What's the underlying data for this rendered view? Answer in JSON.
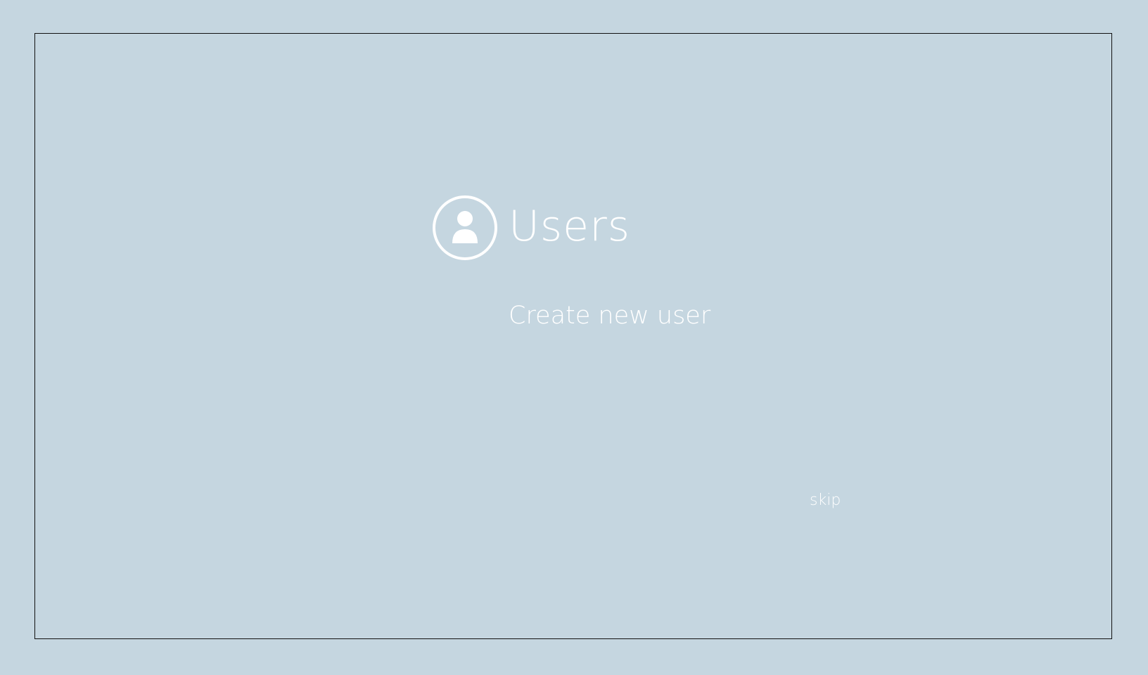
{
  "header": {
    "icon": "user-circle-icon",
    "title": "Users"
  },
  "actions": {
    "create_user_label": "Create new user",
    "skip_label": "skip"
  },
  "colors": {
    "background": "#c5d6e0",
    "text": "#ffffff",
    "border": "#111111"
  }
}
